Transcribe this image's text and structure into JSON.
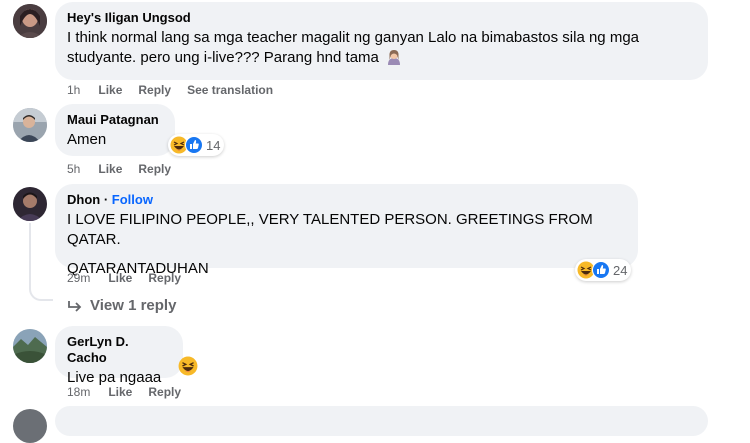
{
  "comments": [
    {
      "author": "Hey's Iligan Ungsod",
      "text_lines": [
        "I think normal lang sa mga teacher magalit ng ganyan Lalo na bimabastos sila ng mga studyante. pero ung i-live??? Parang hnd tama"
      ],
      "time": "1h",
      "like_label": "Like",
      "reply_label": "Reply",
      "translate_label": "See translation"
    },
    {
      "author": "Maui Patagnan",
      "text_lines": [
        "Amen"
      ],
      "time": "5h",
      "like_label": "Like",
      "reply_label": "Reply",
      "reaction_count": "14",
      "reaction_icons": [
        "haha-icon",
        "like-icon"
      ]
    },
    {
      "author": "Dhon",
      "follow_label": "Follow",
      "text_lines": [
        "I LOVE FILIPINO PEOPLE,, VERY TALENTED PERSON. GREETINGS FROM QATAR.",
        "QATARANTADUHAN"
      ],
      "time": "29m",
      "like_label": "Like",
      "reply_label": "Reply",
      "reaction_count": "24",
      "reaction_icons": [
        "haha-icon",
        "like-icon"
      ],
      "view_replies_label": "View 1 reply"
    },
    {
      "author": "GerLyn D. Cacho",
      "text_lines": [
        "Live pa ngaaa"
      ],
      "time": "18m",
      "like_label": "Like",
      "reply_label": "Reply"
    }
  ],
  "colors": {
    "bubble": "#f0f2f5",
    "meta_text": "#65676b",
    "link_blue": "#0866ff",
    "haha_yellow": "#f7b928"
  }
}
